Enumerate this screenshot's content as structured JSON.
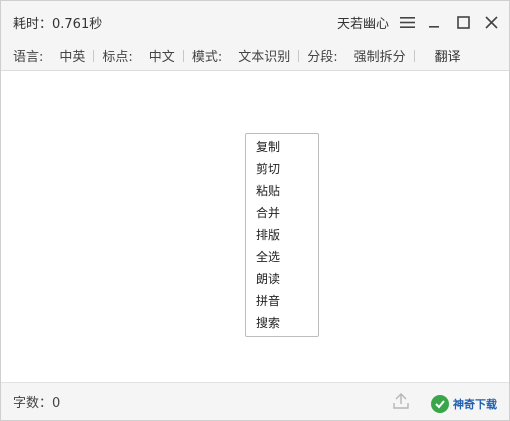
{
  "titlebar": {
    "elapsed": "耗时：0.761秒",
    "user": "天若幽心"
  },
  "toolbar": {
    "language_label": "语言:",
    "language_value": "中英",
    "punct_label": "标点:",
    "punct_value": "中文",
    "mode_label": "模式:",
    "mode_value": "文本识别",
    "segment_label": "分段:",
    "segment_value": "强制拆分",
    "translate": "翻译"
  },
  "context_menu": {
    "items": [
      "复制",
      "剪切",
      "粘贴",
      "合并",
      "排版",
      "全选",
      "朗读",
      "拼音",
      "搜索"
    ]
  },
  "statusbar": {
    "char_count": "字数：0",
    "logo_text": "神奇下载"
  },
  "icons": {
    "menu": "hamburger-menu-icon",
    "minimize": "minimize-icon",
    "maximize": "maximize-icon",
    "close": "close-icon",
    "upload": "upload-icon",
    "logo": "logo-icon"
  },
  "colors": {
    "chrome_bg": "#f5f5f5",
    "logo_green": "#3aa64a",
    "logo_blue": "#1f5fb0"
  }
}
